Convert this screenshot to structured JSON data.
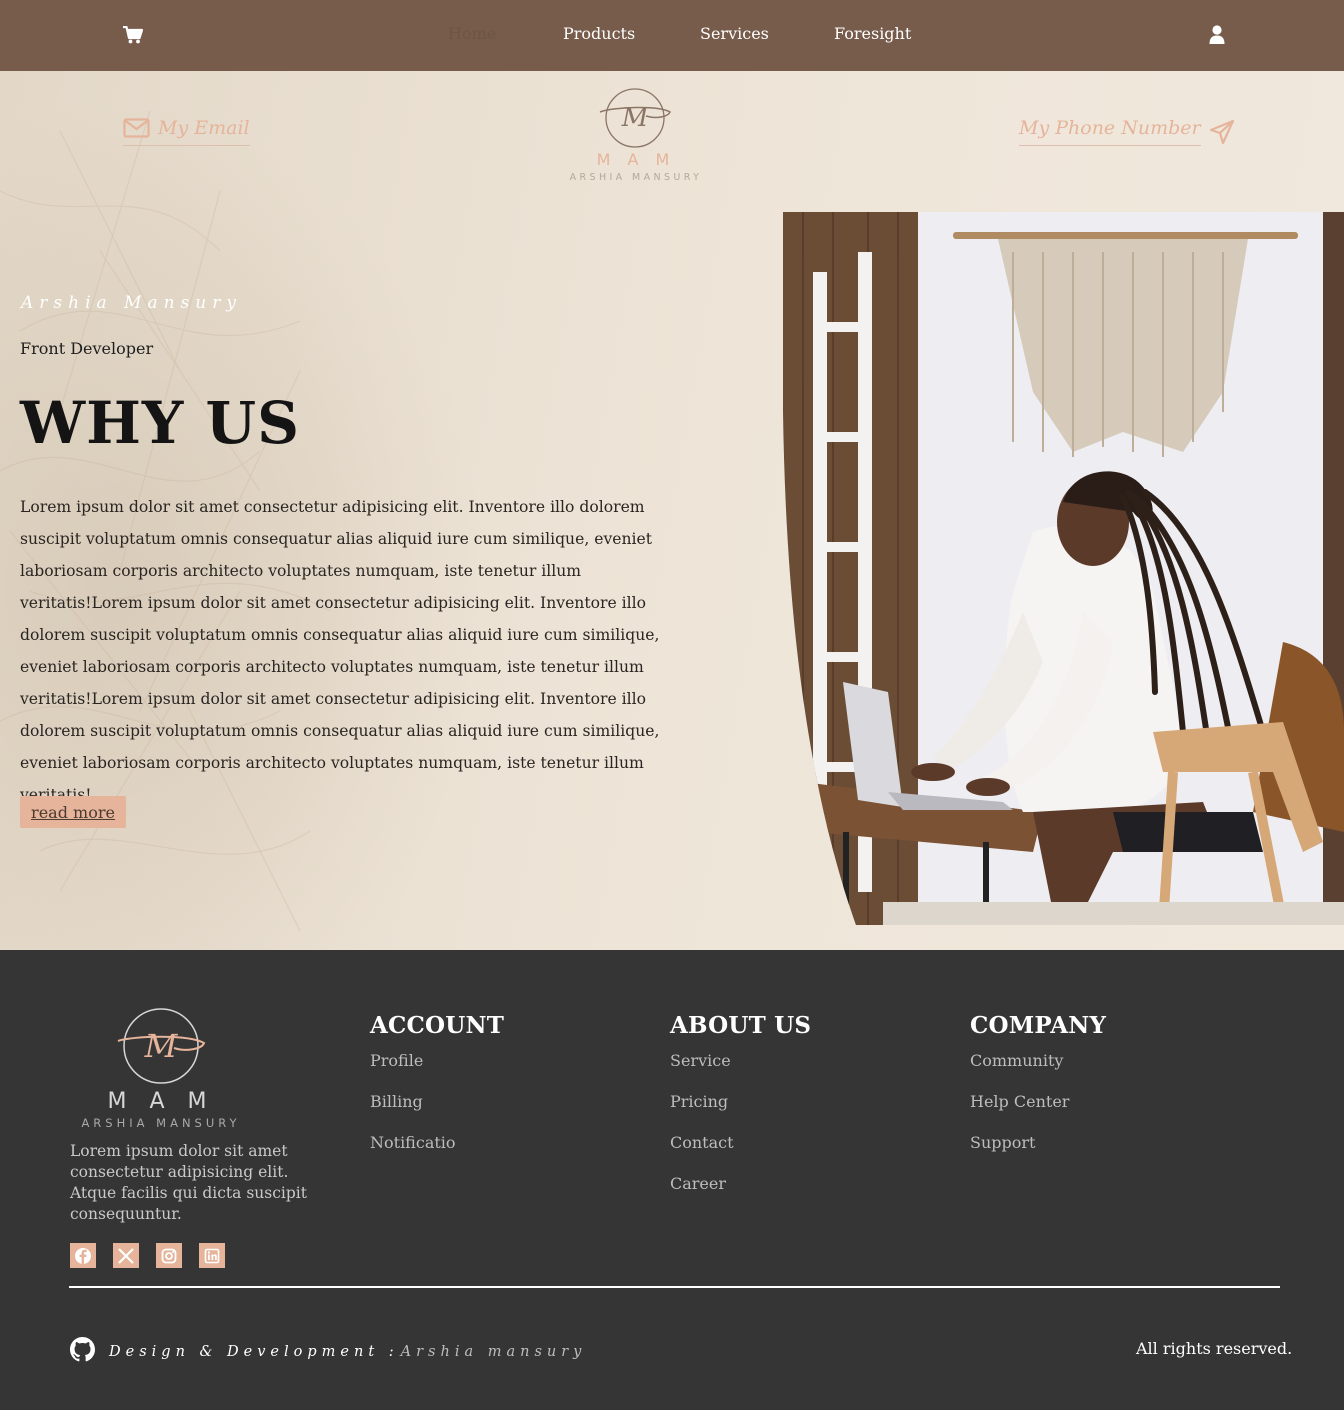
{
  "nav": {
    "cart_icon": "shopping-cart-icon",
    "user_icon": "user-icon",
    "links": [
      {
        "label": "Home",
        "active": true
      },
      {
        "label": "Products"
      },
      {
        "label": "Services"
      },
      {
        "label": "Foresight"
      }
    ]
  },
  "contact": {
    "email_label": "My Email",
    "email_icon": "envelope-icon",
    "phone_label": "My Phone Number",
    "phone_icon": "paper-plane-icon"
  },
  "logo": {
    "monogram": "M",
    "initials": "M A M",
    "name": "ARSHIA MANSURY"
  },
  "hero": {
    "name": "Arshia Mansury",
    "role": "Front Developer",
    "title": "WHY US",
    "body": "Lorem ipsum dolor sit amet consectetur adipisicing elit. Inventore illo dolorem suscipit voluptatum omnis consequatur alias aliquid iure cum similique, eveniet laboriosam corporis architecto voluptates numquam, iste tenetur illum veritatis!Lorem ipsum dolor sit amet consectetur adipisicing elit. Inventore illo dolorem suscipit voluptatum omnis consequatur alias aliquid iure cum similique, eveniet laboriosam corporis architecto voluptates numquam, iste tenetur illum veritatis!Lorem ipsum dolor sit amet consectetur adipisicing elit. Inventore illo dolorem suscipit voluptatum omnis consequatur alias aliquid iure cum similique, eveniet laboriosam corporis architecto voluptates numquam, iste tenetur illum veritatis!",
    "button": "read more"
  },
  "footer": {
    "description": "Lorem ipsum dolor sit amet consectetur adipisicing elit. Atque facilis qui dicta suscipit consequuntur.",
    "socials": [
      "facebook-icon",
      "x-twitter-icon",
      "instagram-icon",
      "linkedin-icon"
    ],
    "columns": [
      {
        "title": "ACCOUNT",
        "links": [
          "Profile",
          "Billing",
          "Notificatio"
        ]
      },
      {
        "title": "ABOUT US",
        "links": [
          "Service",
          "Pricing",
          "Contact",
          "Career"
        ]
      },
      {
        "title": "COMPANY",
        "links": [
          "Community",
          "Help Center",
          "Support"
        ]
      }
    ],
    "credit_icon": "github-icon",
    "credit_label": "Design & Development :",
    "credit_name": "Arshia mansury",
    "rights": "All rights reserved."
  },
  "colors": {
    "nav_bg": "#775b4b",
    "accent": "#e5b49b",
    "footer_bg": "#353535",
    "hero_bg": "#efe4d6"
  }
}
